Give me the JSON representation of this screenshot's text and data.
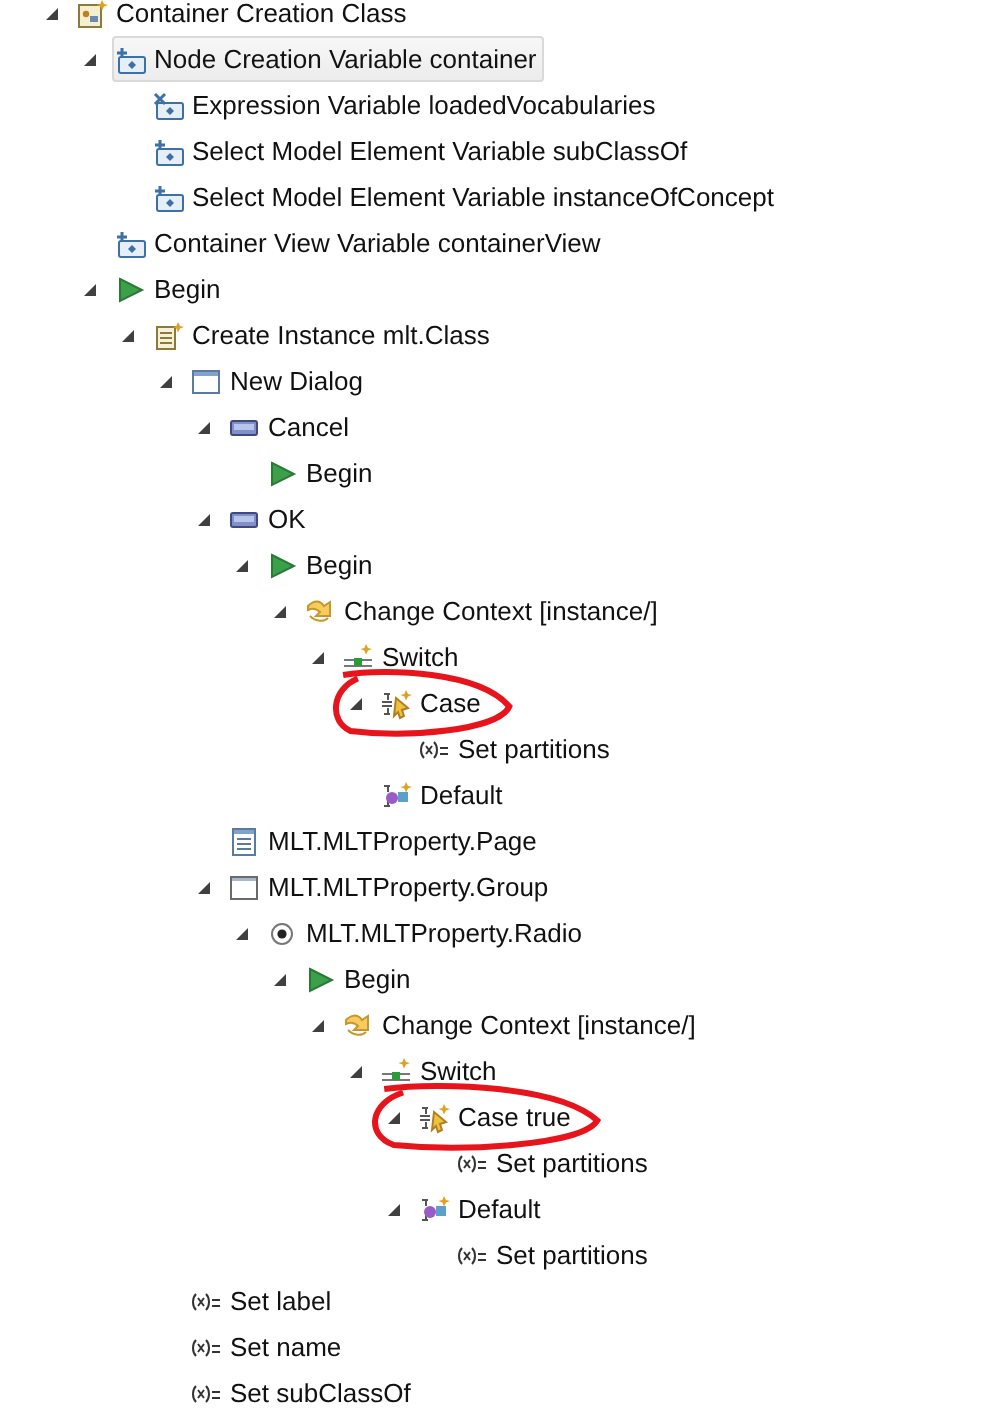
{
  "tree": [
    {
      "label": "Container Creation Class",
      "kind": "class",
      "expanded": true,
      "selected": false,
      "children": [
        {
          "label": "Node Creation Variable container",
          "kind": "variable",
          "expanded": true,
          "selected": true,
          "children": [
            {
              "label": "Expression Variable loadedVocabularies",
              "kind": "expression-variable",
              "selected": false
            },
            {
              "label": "Select Model Element Variable subClassOf",
              "kind": "variable",
              "selected": false
            },
            {
              "label": "Select Model Element Variable instanceOfConcept",
              "kind": "variable",
              "selected": false
            }
          ]
        },
        {
          "label": "Container View Variable containerView",
          "kind": "variable",
          "selected": false
        },
        {
          "label": "Begin",
          "kind": "begin",
          "expanded": true,
          "selected": false,
          "children": [
            {
              "label": "Create Instance mlt.Class",
              "kind": "create",
              "expanded": true,
              "selected": false,
              "children": [
                {
                  "label": "New Dialog",
                  "kind": "dialog",
                  "expanded": true,
                  "selected": false,
                  "children": [
                    {
                      "label": "Cancel",
                      "kind": "button",
                      "expanded": true,
                      "selected": false,
                      "children": [
                        {
                          "label": "Begin",
                          "kind": "begin",
                          "selected": false
                        }
                      ]
                    },
                    {
                      "label": "OK",
                      "kind": "button",
                      "expanded": true,
                      "selected": false,
                      "children": [
                        {
                          "label": "Begin",
                          "kind": "begin",
                          "expanded": true,
                          "selected": false,
                          "children": [
                            {
                              "label": "Change Context [instance/]",
                              "kind": "context",
                              "expanded": true,
                              "selected": false,
                              "children": [
                                {
                                  "label": "Switch",
                                  "kind": "switch",
                                  "expanded": true,
                                  "selected": false,
                                  "children": [
                                    {
                                      "label": "Case",
                                      "kind": "case",
                                      "expanded": true,
                                      "selected": false,
                                      "circled": true,
                                      "children": [
                                        {
                                          "label": "Set partitions",
                                          "kind": "set",
                                          "selected": false
                                        }
                                      ]
                                    },
                                    {
                                      "label": "Default",
                                      "kind": "default",
                                      "selected": false
                                    }
                                  ]
                                }
                              ]
                            }
                          ]
                        }
                      ]
                    },
                    {
                      "label": "MLT.MLTProperty.Page",
                      "kind": "page",
                      "selected": false
                    },
                    {
                      "label": "MLT.MLTProperty.Group",
                      "kind": "group",
                      "expanded": true,
                      "selected": false,
                      "children": [
                        {
                          "label": "MLT.MLTProperty.Radio",
                          "kind": "radio",
                          "expanded": true,
                          "selected": false,
                          "children": [
                            {
                              "label": "Begin",
                              "kind": "begin",
                              "expanded": true,
                              "selected": false,
                              "children": [
                                {
                                  "label": "Change Context [instance/]",
                                  "kind": "context",
                                  "expanded": true,
                                  "selected": false,
                                  "children": [
                                    {
                                      "label": "Switch",
                                      "kind": "switch",
                                      "expanded": true,
                                      "selected": false,
                                      "children": [
                                        {
                                          "label": "Case true",
                                          "kind": "case",
                                          "expanded": true,
                                          "selected": false,
                                          "circled": true,
                                          "children": [
                                            {
                                              "label": "Set partitions",
                                              "kind": "set",
                                              "selected": false
                                            }
                                          ]
                                        },
                                        {
                                          "label": "Default",
                                          "kind": "default",
                                          "expanded": true,
                                          "selected": false,
                                          "children": [
                                            {
                                              "label": "Set partitions",
                                              "kind": "set",
                                              "selected": false
                                            }
                                          ]
                                        }
                                      ]
                                    }
                                  ]
                                }
                              ]
                            }
                          ]
                        }
                      ]
                    }
                  ]
                },
                {
                  "label": "Set label",
                  "kind": "set",
                  "selected": false
                },
                {
                  "label": "Set name",
                  "kind": "set",
                  "selected": false
                },
                {
                  "label": "Set subClassOf",
                  "kind": "set",
                  "selected": false
                }
              ]
            }
          ]
        }
      ]
    }
  ]
}
